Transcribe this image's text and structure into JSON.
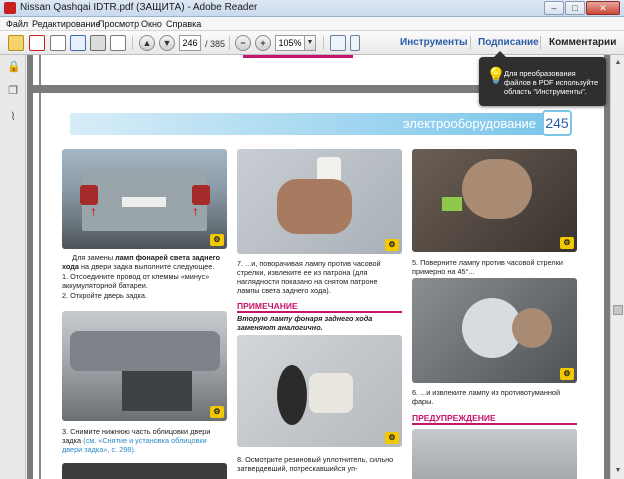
{
  "window": {
    "title": "Nissan Qashqai IDTR.pdf (ЗАЩИТА) - Adobe Reader",
    "minimize": "–",
    "maximize": "□",
    "close": "✕"
  },
  "menu": {
    "items": [
      "Файл",
      "Редактирование",
      "Просмотр",
      "Окно",
      "Справка"
    ]
  },
  "toolbar": {
    "page_current": "246",
    "page_total": "/ 385",
    "zoom": "105%",
    "zoom_out": "−",
    "zoom_in": "+",
    "tools_label": "Инструменты",
    "sign_label": "Подписание",
    "comments_label": "Комментарии"
  },
  "tooltip": {
    "text": "Для преобразования файлов в PDF используйте область \"Инструменты\"."
  },
  "page": {
    "section_title": "электрооборудование",
    "page_number": "245",
    "col1": {
      "text1_pre": "Для замены ",
      "text1_bold": "ламп фонарей света заднего хода",
      "text1_post": " на двери задка выполните следующее.",
      "step1": "1. Отсоедините провод от клеммы «минус» аккумуляторной батареи.",
      "step2": "2. Откройте дверь задка.",
      "step3_pre": "3. Снимите нижнюю часть облицовки двери задка ",
      "step3_link": "(см. «Снятие и установка облицовки двери задка», с. 298)."
    },
    "col2": {
      "step7": "7. ...и, поворачивая лампу против часовой стрелки, извлеките ее из патрона (для наглядности показано на снятом патроне лампы света заднего хода).",
      "note_heading": "ПРИМЕЧАНИЕ",
      "note_text": "Вторую лампу фонаря заднего хода заменяют аналогично.",
      "step8": "8. Осмотрите резиновый уплотнитель, сильно затвердевший, потрескавшийся уп-"
    },
    "col3": {
      "step5": "5. Поверните лампу против часовой стрелки примерно на 45°...",
      "step6": "6. ...и извлеките лампу из противотуманной фары.",
      "warning_heading": "ПРЕДУПРЕЖДЕНИЕ"
    }
  },
  "colors": {
    "accent_blue": "#7cc6ea",
    "note_magenta": "#c4146b",
    "link_blue": "#2a8ac9",
    "adobe_red": "#c8211f"
  }
}
